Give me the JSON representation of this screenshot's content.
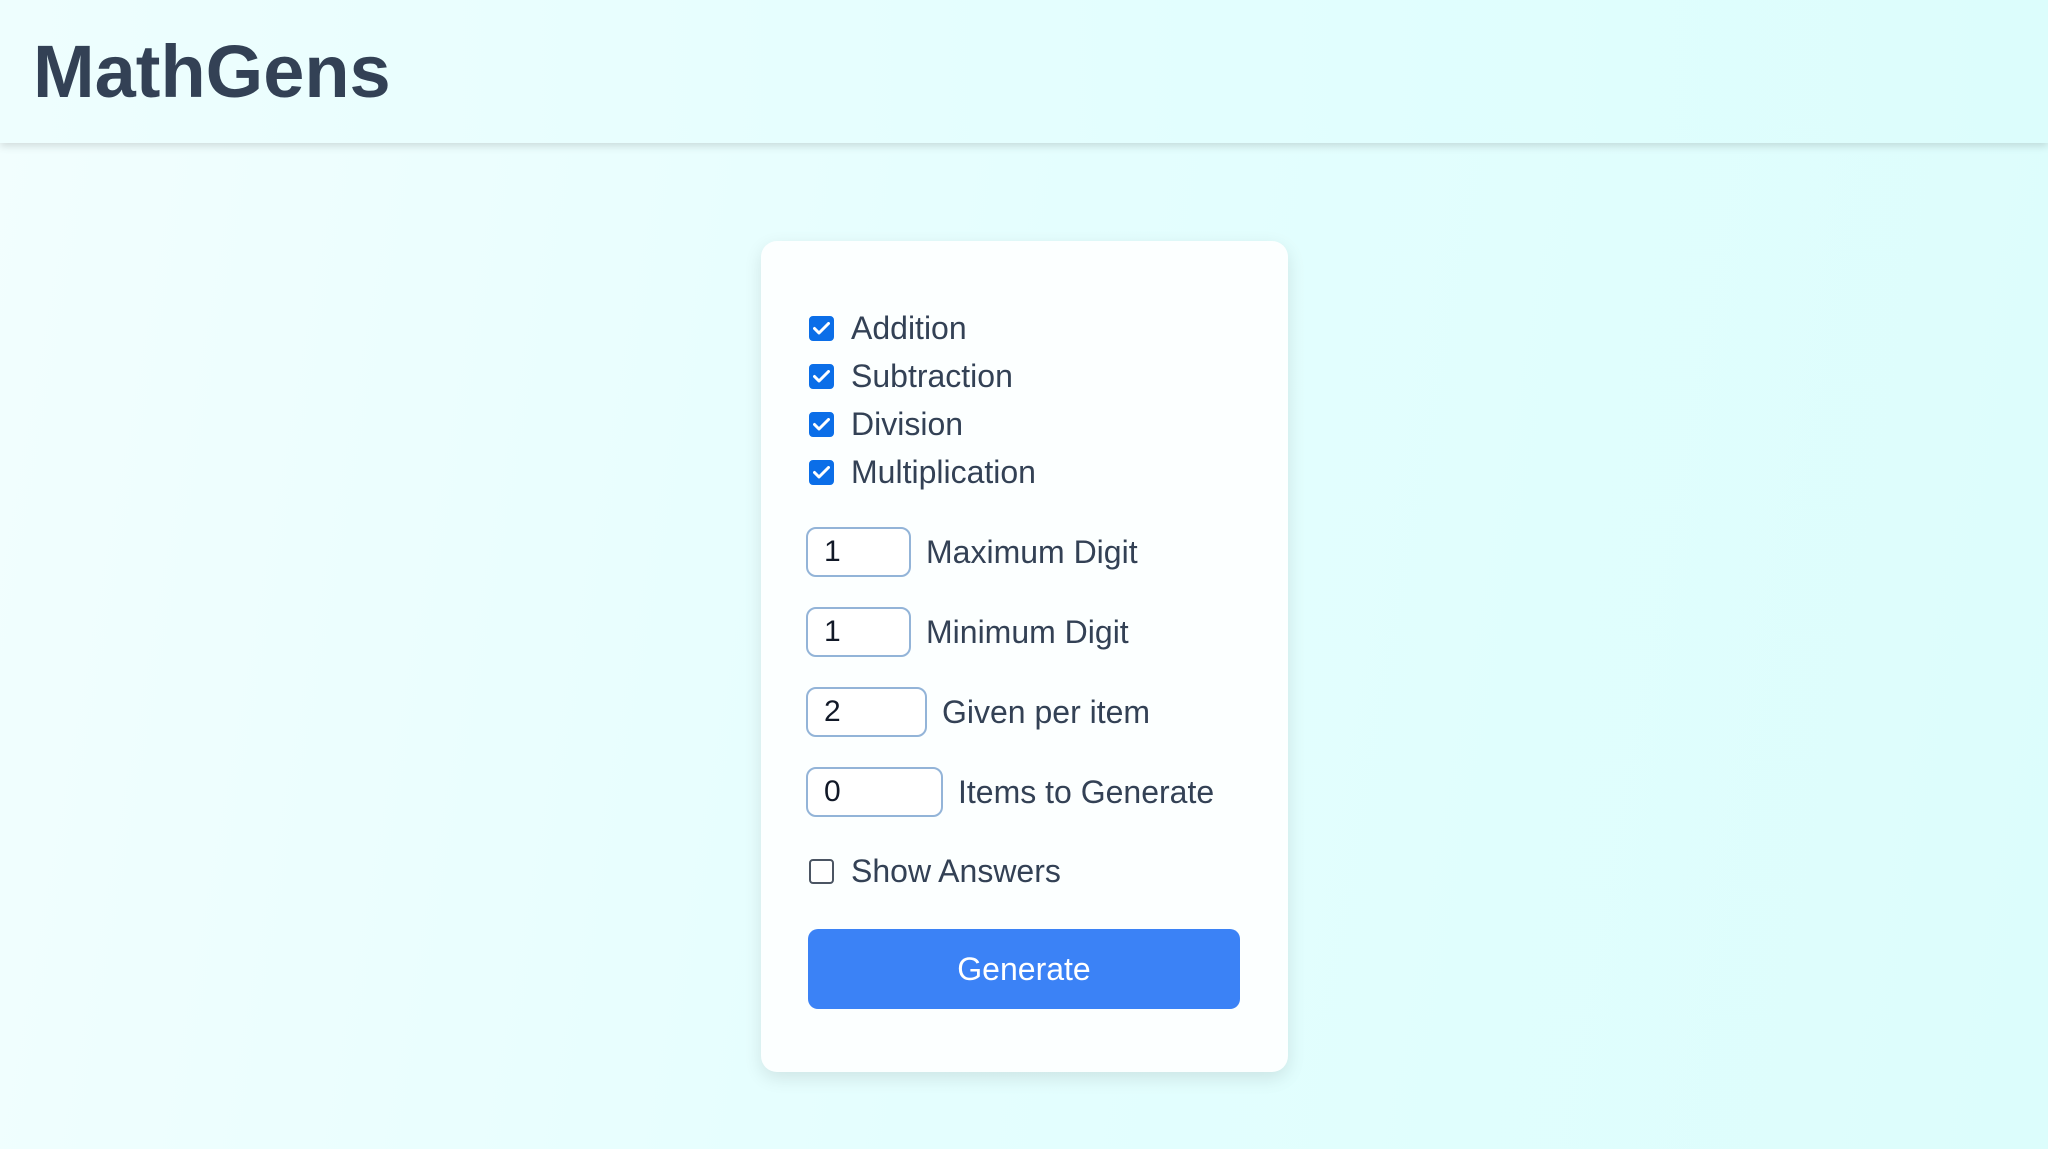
{
  "header": {
    "title": "MathGens"
  },
  "form": {
    "operations": [
      {
        "label": "Addition",
        "checked": true
      },
      {
        "label": "Subtraction",
        "checked": true
      },
      {
        "label": "Division",
        "checked": true
      },
      {
        "label": "Multiplication",
        "checked": true
      }
    ],
    "fields": [
      {
        "label": "Maximum Digit",
        "value": "1"
      },
      {
        "label": "Minimum Digit",
        "value": "1"
      },
      {
        "label": "Given per item",
        "value": "2"
      },
      {
        "label": "Items to Generate",
        "value": "0"
      }
    ],
    "show_answers": {
      "label": "Show Answers",
      "checked": false
    },
    "generate_label": "Generate"
  },
  "colors": {
    "accent": "#3b82f6",
    "checkbox": "#0b6ee8",
    "text": "#334155"
  },
  "icons": {
    "check": "checkmark-icon"
  }
}
